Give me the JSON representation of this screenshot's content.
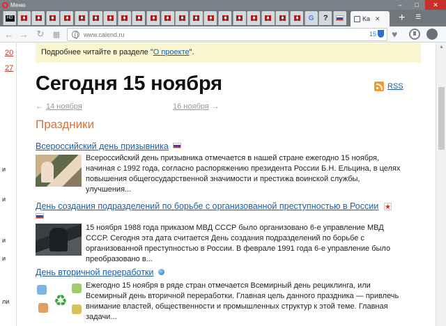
{
  "browser": {
    "menu_label": "Меню",
    "active_tab_label": "Ka",
    "new_tab_symbol": "+",
    "window_controls": [
      "–",
      "□",
      "✕"
    ],
    "pinned_tabs": [
      {
        "icon": "hd-icon",
        "text": "HD"
      },
      {
        "icon": "flag-icon"
      },
      {
        "icon": "flag-icon"
      },
      {
        "icon": "flag-icon"
      },
      {
        "icon": "flag-icon"
      },
      {
        "icon": "flag-icon"
      },
      {
        "icon": "flag-icon"
      },
      {
        "icon": "flag-icon"
      },
      {
        "icon": "flag-icon"
      },
      {
        "icon": "flag-icon"
      },
      {
        "icon": "flag-icon"
      },
      {
        "icon": "flag-icon"
      },
      {
        "icon": "flag-icon"
      },
      {
        "icon": "flag-icon"
      },
      {
        "icon": "flag-icon"
      },
      {
        "icon": "flag-icon"
      },
      {
        "icon": "flag-icon"
      },
      {
        "icon": "flag-icon"
      },
      {
        "icon": "flag-icon"
      },
      {
        "icon": "flag-icon"
      },
      {
        "icon": "flag-icon"
      },
      {
        "icon": "google-icon",
        "text": "G"
      },
      {
        "icon": "question-icon",
        "text": "?"
      },
      {
        "icon": "russia-flag-icon"
      }
    ],
    "address": {
      "url": "www.calend.ru",
      "counter": "15"
    },
    "colors": {
      "titlebar": "#7a8287",
      "opera_red": "#ff1b2d",
      "link": "#1a5fa8",
      "section": "#e07030",
      "notice_bg": "#f8f5cf"
    }
  },
  "sidebar": {
    "day_links": [
      "20",
      "27"
    ],
    "fragments": [
      "и",
      "и",
      "и",
      "и",
      "ли"
    ]
  },
  "notice": {
    "text": "Подробнее читайте в разделе \"",
    "link": "О проекте",
    "tail": "\"."
  },
  "page": {
    "title": "Сегодня 15 ноября",
    "rss_label": "RSS",
    "prev_arrow": "←",
    "prev_label": "14 ноября",
    "next_label": "16 ноября",
    "next_arrow": "→",
    "section_title": "Праздники"
  },
  "holidays": [
    {
      "title": "Всероссийский день призывника",
      "badge": "russia-flag-icon",
      "text": "Всероссийский день призывника отмечается в нашей стране ежегодно 15 ноября, начиная с 1992 года, согласно распоряжению президента России Б.Н. Ельцина, в целях повышения общегосударственной значимости и престижа воинской службы, улучшения..."
    },
    {
      "title": "День создания подразделений по борьбе с организованной преступностью в России",
      "badge": "star-icon",
      "text": "15 ноября 1988 года приказом МВД СССР было организовано 6-е управление МВД СССР. Сегодня эта дата считается День создания подразделений по борьбе с организованной преступностью в России. В феврале 1991 года 6-е управление было преобразовано в..."
    },
    {
      "title": "День вторичной переработки",
      "badge": "globe-icon",
      "text": "Ежегодно 15 ноября в ряде стран отмечается Всемирный день рециклинга, или Всемирный день вторичной переработки. Главная цель данного праздника — привлечь внимание властей, общественности и промышленных структур к этой теме. Главная задачи..."
    }
  ]
}
